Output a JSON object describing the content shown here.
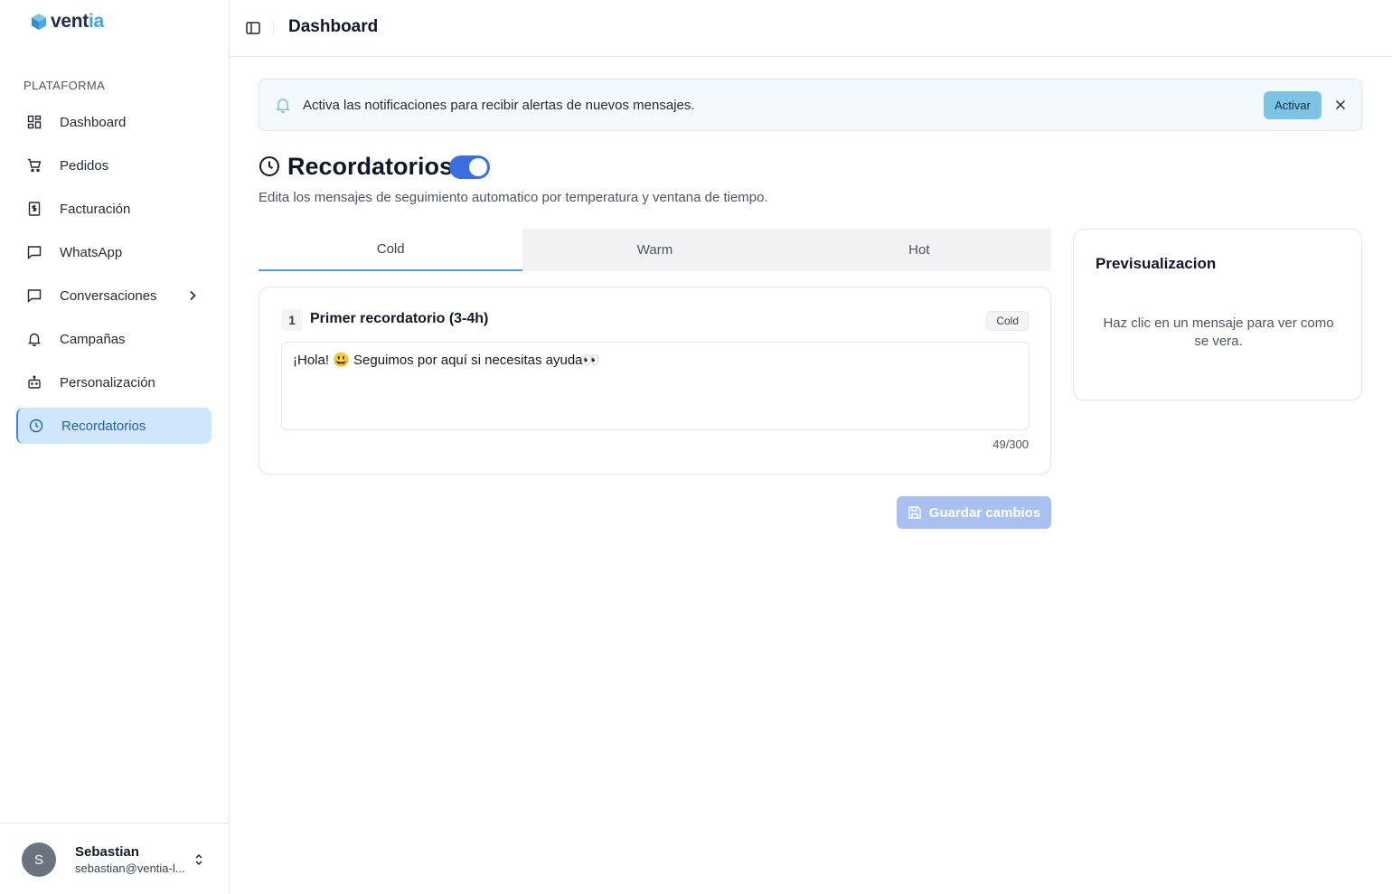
{
  "brand": {
    "logo_main": "vent",
    "logo_accent": "ia"
  },
  "sidebar": {
    "section_label": "PLATAFORMA",
    "items": [
      {
        "label": "Dashboard",
        "icon": "dashboard-icon"
      },
      {
        "label": "Pedidos",
        "icon": "cart-icon"
      },
      {
        "label": "Facturación",
        "icon": "receipt-icon"
      },
      {
        "label": "WhatsApp",
        "icon": "chat-icon"
      },
      {
        "label": "Conversaciones",
        "icon": "chat-icon",
        "has_submenu": true
      },
      {
        "label": "Campañas",
        "icon": "bell-icon"
      },
      {
        "label": "Personalización",
        "icon": "bot-icon"
      },
      {
        "label": "Recordatorios",
        "icon": "clock-icon",
        "active": true
      }
    ],
    "user": {
      "initial": "S",
      "name": "Sebastian",
      "email": "sebastian@ventia-l..."
    }
  },
  "header": {
    "title": "Dashboard"
  },
  "banner": {
    "text": "Activa las notificaciones para recibir alertas de nuevos mensajes.",
    "button_label": "Activar"
  },
  "page": {
    "title": "Recordatorios",
    "enabled": true,
    "subtitle": "Edita los mensajes de seguimiento automatico por temperatura y ventana de tiempo."
  },
  "tabs": [
    {
      "label": "Cold",
      "active": true
    },
    {
      "label": "Warm",
      "active": false
    },
    {
      "label": "Hot",
      "active": false
    }
  ],
  "reminder": {
    "number": "1",
    "title": "Primer recordatorio (3-4h)",
    "badge": "Cold",
    "message": "¡Hola! 😃 Seguimos por aquí si necesitas ayuda👀",
    "counter": "49/300"
  },
  "save_button": {
    "label": "Guardar cambios",
    "disabled": true
  },
  "preview": {
    "title": "Previsualizacion",
    "hint": "Haz clic en un mensaje para ver como se vera."
  },
  "colors": {
    "accent": "#3b6fe0",
    "active_nav_bg": "#cfe6fb",
    "brand_accent": "#3aa7de"
  }
}
